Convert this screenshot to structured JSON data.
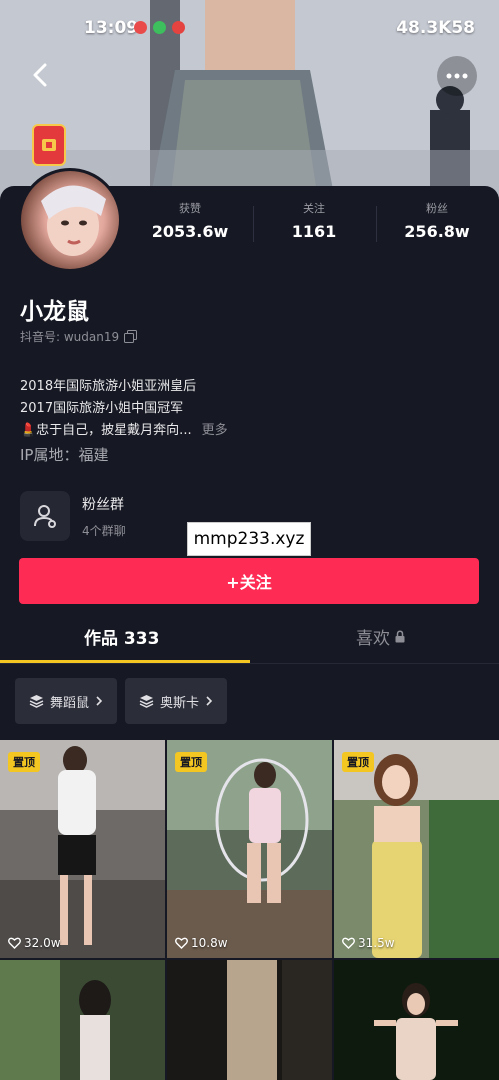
{
  "status_bar": {
    "time": "13:09",
    "network": "48.3K58"
  },
  "profile": {
    "nickname": "小龙鼠",
    "douyin_id": "抖音号: wudan19",
    "stats": [
      {
        "label": "获赞",
        "value": "2053.6w"
      },
      {
        "label": "关注",
        "value": "1161"
      },
      {
        "label": "粉丝",
        "value": "256.8w"
      }
    ],
    "bio_lines": [
      "2018年国际旅游小姐亚洲皇后",
      "2017国际旅游小姐中国冠军",
      "💄忠于自己，披星戴月奔向..."
    ],
    "bio_more": "更多",
    "ip_location": "IP属地：福建"
  },
  "fan_group": {
    "title": "粉丝群",
    "subtitle": "4个群聊"
  },
  "watermark": "mmp233.xyz",
  "follow_button": "+关注",
  "tabs": {
    "works": "作品 333",
    "likes": "喜欢"
  },
  "collections": [
    {
      "label": "舞蹈鼠"
    },
    {
      "label": "奥斯卡"
    }
  ],
  "videos": [
    {
      "pinned": "置顶",
      "likes": "32.0w"
    },
    {
      "pinned": "置顶",
      "likes": "10.8w"
    },
    {
      "pinned": "置顶",
      "likes": "31.5w"
    }
  ],
  "colors": {
    "background": "#161823",
    "accent_red": "#fe2c55",
    "tab_indicator": "#f4c622"
  },
  "icons": [
    "back-arrow-icon",
    "more-icon",
    "red-packet-icon",
    "copy-icon",
    "fan-group-icon",
    "lock-icon",
    "collection-icon",
    "chevron-right-icon",
    "heart-icon"
  ]
}
